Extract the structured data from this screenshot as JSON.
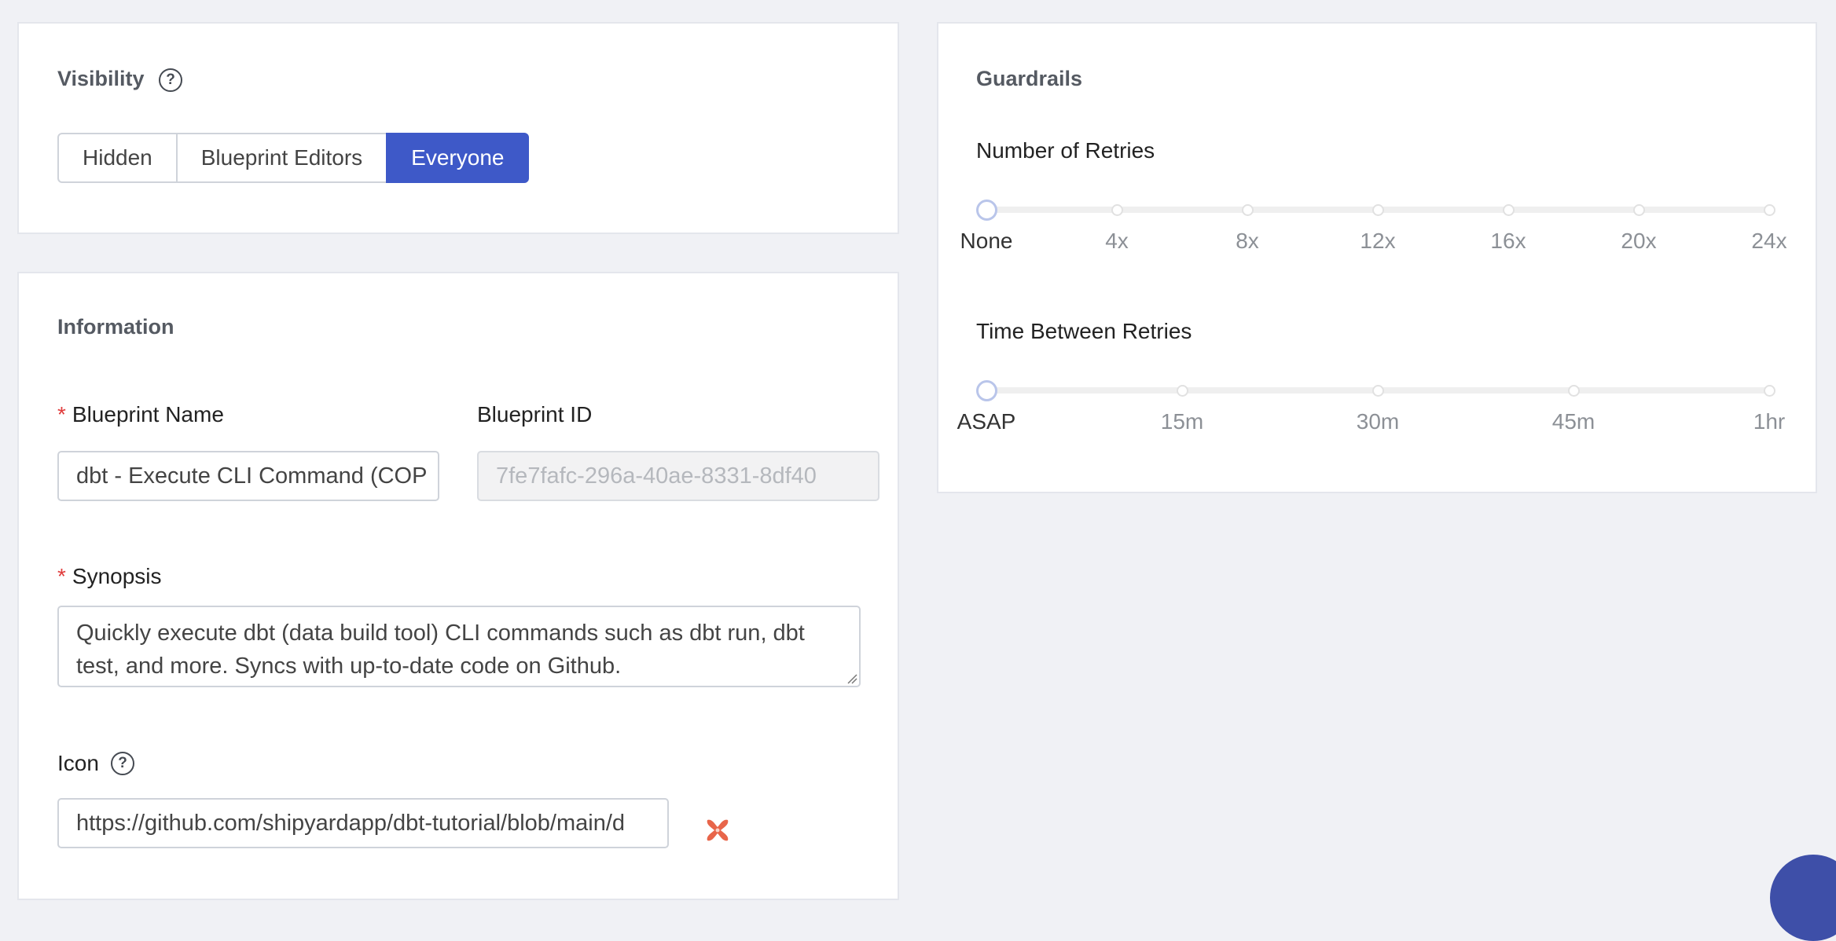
{
  "visibility": {
    "title": "Visibility",
    "help_icon": "question-circle-icon",
    "options": [
      "Hidden",
      "Blueprint Editors",
      "Everyone"
    ],
    "selected": "Everyone"
  },
  "information": {
    "title": "Information",
    "blueprint_name": {
      "label": "Blueprint Name",
      "required_mark": "*",
      "value": "dbt - Execute CLI Command (COP"
    },
    "blueprint_id": {
      "label": "Blueprint ID",
      "value": "7fe7fafc-296a-40ae-8331-8df40"
    },
    "synopsis": {
      "label": "Synopsis",
      "required_mark": "*",
      "value": "Quickly execute dbt (data build tool) CLI commands such as dbt run, dbt test, and more. Syncs with up-to-date code on Github."
    },
    "icon": {
      "label": "Icon",
      "help_icon": "question-circle-icon",
      "value": "https://github.com/shipyardapp/dbt-tutorial/blob/main/d",
      "preview_icon": "dbt-logo-icon"
    }
  },
  "guardrails": {
    "title": "Guardrails",
    "retries": {
      "label": "Number of Retries",
      "ticks": [
        "None",
        "4x",
        "8x",
        "12x",
        "16x",
        "20x",
        "24x"
      ],
      "selected_index": 0
    },
    "time_between": {
      "label": "Time Between Retries",
      "ticks": [
        "ASAP",
        "15m",
        "30m",
        "45m",
        "1hr"
      ],
      "selected_index": 0
    }
  },
  "colors": {
    "accent": "#3e59c8",
    "required": "#e03b3b",
    "dbt_logo": "#e8654a",
    "background": "#f0f1f5"
  }
}
